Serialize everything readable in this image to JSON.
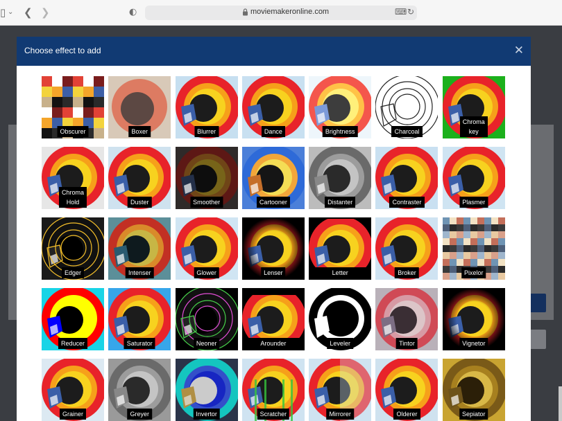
{
  "browser": {
    "url": "moviemakeronline.com"
  },
  "modal": {
    "title": "Choose effect to add",
    "close_icon": "close-icon"
  },
  "effects": [
    {
      "label": "Obscurer",
      "style": "pixel",
      "bg": "#bcd9ee"
    },
    {
      "label": "Boxer",
      "style": "blur",
      "bg": "#d8c9b8"
    },
    {
      "label": "Blurrer",
      "style": "soft",
      "bg": "#c6dff0"
    },
    {
      "label": "Dance",
      "style": "normal",
      "bg": "#c8e0f1"
    },
    {
      "label": "Brightness",
      "style": "bright",
      "bg": "#eef6fb"
    },
    {
      "label": "Charcoal",
      "style": "sketch",
      "bg": "#ffffff"
    },
    {
      "label": "Chroma\nkey",
      "style": "green",
      "bg": "#1cb01c"
    },
    {
      "label": "Chroma\nHold",
      "style": "hold",
      "bg": "#e6e6e6"
    },
    {
      "label": "Duster",
      "style": "normal",
      "bg": "#cfe2ef"
    },
    {
      "label": "Smoother",
      "style": "dark",
      "bg": "#2f2a29"
    },
    {
      "label": "Cartooner",
      "style": "cartoon",
      "bg": "#4b7fd9"
    },
    {
      "label": "Distanter",
      "style": "gray",
      "bg": "#bcbcbc"
    },
    {
      "label": "Contraster",
      "style": "normal",
      "bg": "#c9e0f1"
    },
    {
      "label": "Plasmer",
      "style": "normal",
      "bg": "#cfe4f2"
    },
    {
      "label": "Edger",
      "style": "edge",
      "bg": "#1a1a1a"
    },
    {
      "label": "Intenser",
      "style": "teal",
      "bg": "#5c8f99"
    },
    {
      "label": "Glower",
      "style": "soft",
      "bg": "#d0e5f3"
    },
    {
      "label": "Lenser",
      "style": "lens",
      "bg": "#000000"
    },
    {
      "label": "Letter",
      "style": "letter",
      "bg": "#000000"
    },
    {
      "label": "Broker",
      "style": "normal",
      "bg": "#cfe3f2"
    },
    {
      "label": "Pixelor",
      "style": "pixel2",
      "bg": "#a9c7dd"
    },
    {
      "label": "Reducer",
      "style": "reduce",
      "bg": "#18d4e6"
    },
    {
      "label": "Saturator",
      "style": "normal",
      "bg": "#37a6ea"
    },
    {
      "label": "Neoner",
      "style": "neon",
      "bg": "#000000"
    },
    {
      "label": "Arounder",
      "style": "around",
      "bg": "#000000"
    },
    {
      "label": "Leveler",
      "style": "level",
      "bg": "#ffffff"
    },
    {
      "label": "Tintor",
      "style": "tint",
      "bg": "#b9b1b9"
    },
    {
      "label": "Vignetor",
      "style": "vignette",
      "bg": "#000000"
    },
    {
      "label": "Grainer",
      "style": "soft",
      "bg": "#dce9f2"
    },
    {
      "label": "Greyer",
      "style": "gray",
      "bg": "#9a9a9a"
    },
    {
      "label": "Invertor",
      "style": "invert",
      "bg": "#2f3a52"
    },
    {
      "label": "Scratcher",
      "style": "scratch",
      "bg": "#cfe3f1"
    },
    {
      "label": "Mirrorer",
      "style": "mirror",
      "bg": "#cfe3f1"
    },
    {
      "label": "Olderer",
      "style": "normal",
      "bg": "#cfe2ef"
    },
    {
      "label": "Sepiator",
      "style": "sepia",
      "bg": "#c9a431"
    }
  ]
}
